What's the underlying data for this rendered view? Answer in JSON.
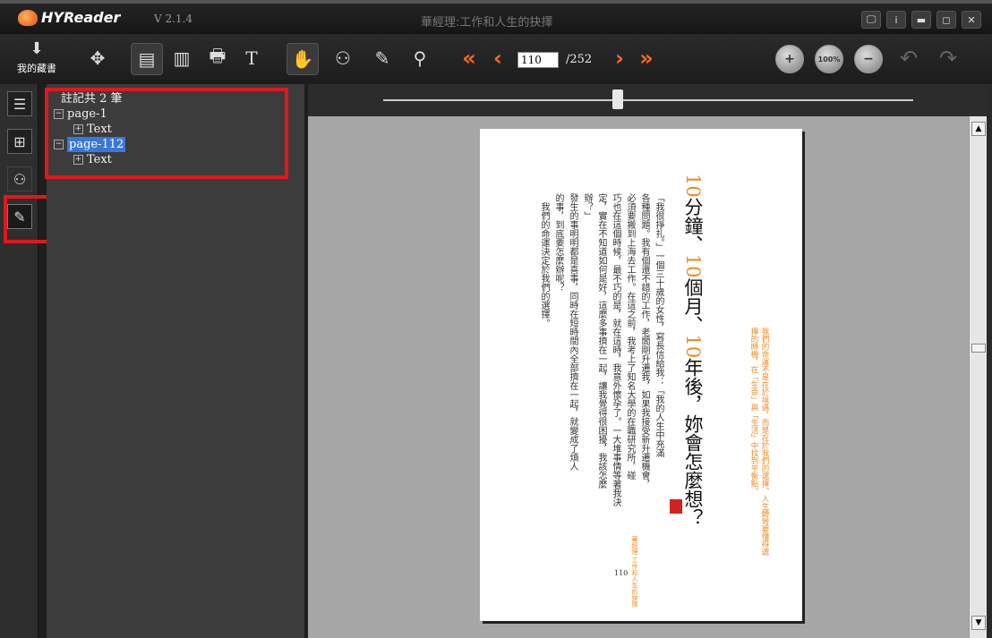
{
  "app": {
    "name": "HYReader",
    "version": "V 2.1.4",
    "document_title": "華經理:工作和人生的抉擇"
  },
  "window_controls": [
    "🖵",
    "i",
    "▬",
    "◻",
    "✕"
  ],
  "toolbar": {
    "library_label": "我的藏書",
    "page_current": "110",
    "page_total": "/252",
    "zoom_100_label": "100%",
    "text_tool_label": "T"
  },
  "sidebar_tabs": [
    "thumbnails",
    "grid",
    "search",
    "notes"
  ],
  "notes_panel": {
    "header": "註記共 2 筆",
    "items": [
      {
        "page": "page-1",
        "child": "Text",
        "selected": false
      },
      {
        "page": "page-112",
        "child": "Text",
        "selected": true
      }
    ]
  },
  "page_content": {
    "title_chars": [
      "10",
      "分",
      "鐘",
      "、",
      "10",
      "個",
      "月",
      "、",
      "10",
      "年",
      "後",
      "，",
      "妳",
      "會",
      "怎",
      "麼",
      "想",
      "？"
    ],
    "body_columns": [
      "「我很掙扎。」一個三十歲的女性，寫長信給我：「我的人生中充滿",
      "各種問題。我有個還不錯的工作，老闆剛升遷我，如果我接受新升遷機會，",
      "必須要搬到上海去工作。在這之前，我考上了知名大學的在職研究所，碰",
      "巧也在這個時候，最不巧的是，就在這時，我意外懷孕了。一大堆事情等著我決",
      "定，實在不知道如何是好，這麼多事擠在一起，讓我覺得很困擾，我該怎麼",
      "辦？」",
      "發生的事明明都是喜事，同時在短時間內全部擠在一起，就變成了煩人",
      "的事，到底要怎麼辦呢？",
      "我們的命運決定於我們的選擇。"
    ],
    "side_note": "我們的命運不是在於境遇，而是在於我們的選擇。人生轉彎要懂得選擇的時機，在「生命」與「生活」中找到平衡點。",
    "footer": "華經理 工作和人生的抉擇",
    "page_number": "110"
  },
  "colors": {
    "accent_orange": "#ff6a1a",
    "highlight_red": "#e3161d",
    "selection_blue": "#3a78d8"
  }
}
